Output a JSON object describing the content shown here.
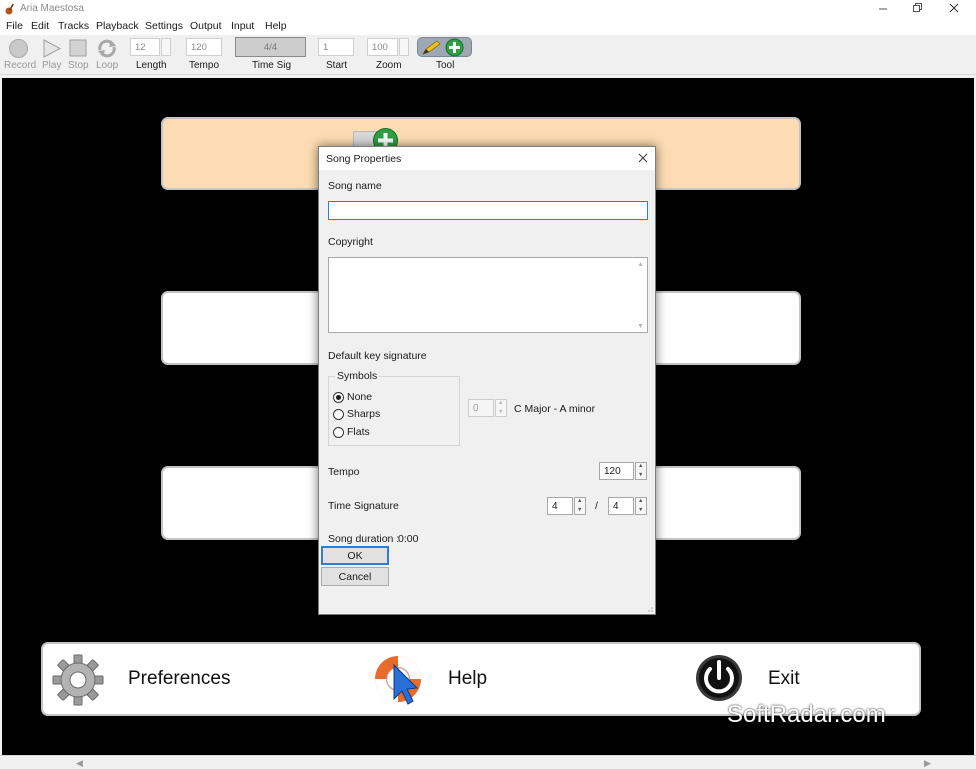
{
  "window": {
    "title": "Aria Maestosa"
  },
  "menu": [
    "File",
    "Edit",
    "Tracks",
    "Playback",
    "Settings",
    "Output",
    "Input",
    "Help"
  ],
  "toolbar": {
    "record": "Record",
    "play": "Play",
    "stop": "Stop",
    "loop": "Loop",
    "length_value": "12",
    "length_label": "Length",
    "tempo_value": "120",
    "tempo_label": "Tempo",
    "timesig_value": "4/4",
    "timesig_label": "Time Sig",
    "start_value": "1",
    "start_label": "Start",
    "zoom_value": "100",
    "zoom_label": "Zoom",
    "tool_label": "Tool"
  },
  "bottom_bar": {
    "preferences": "Preferences",
    "help": "Help",
    "exit": "Exit"
  },
  "watermark": "SoftRadar.com",
  "dialog": {
    "title": "Song Properties",
    "song_name_label": "Song name",
    "song_name_value": "",
    "copyright_label": "Copyright",
    "copyright_value": "",
    "key_signature_label": "Default key signature",
    "symbols_label": "Symbols",
    "symbol_options": [
      "None",
      "Sharps",
      "Flats"
    ],
    "symbol_selected": "None",
    "key_count_value": "0",
    "key_name": "C Major - A minor",
    "tempo_label": "Tempo",
    "tempo_value": "120",
    "time_signature_label": "Time Signature",
    "time_sig_num": "4",
    "time_sig_sep": "/",
    "time_sig_den": "4",
    "duration_label": "Song duration :",
    "duration_value": "0:00",
    "ok": "OK",
    "cancel": "Cancel"
  },
  "colors": {
    "canvas_bg": "#000000",
    "track_selected_bg": "#fddcb3",
    "focus_blue": "#2f7dd6"
  }
}
